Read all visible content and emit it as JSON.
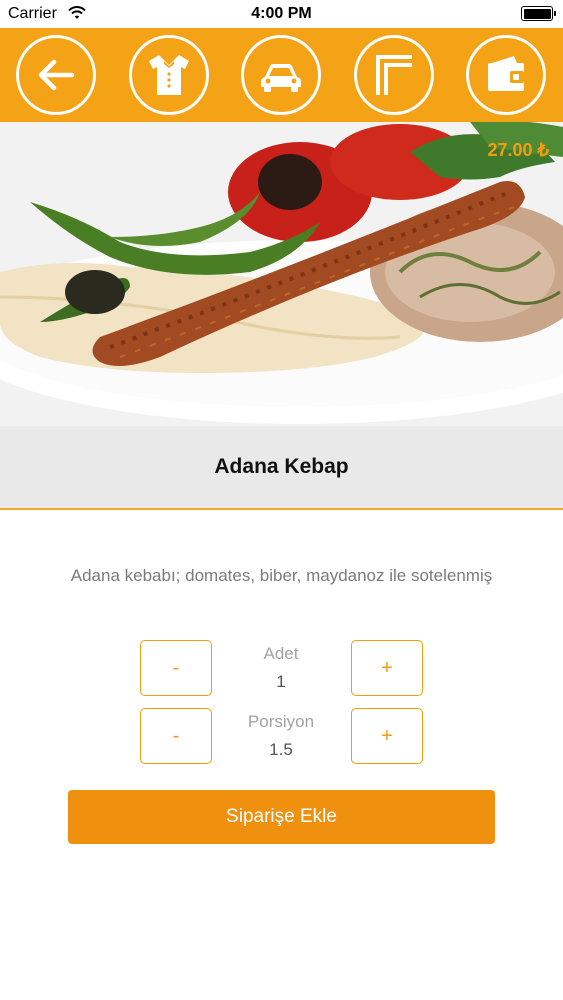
{
  "status_bar": {
    "carrier": "Carrier",
    "time": "4:00 PM"
  },
  "toolbar": {
    "background": "#f5a316",
    "icons": [
      "back-arrow-icon",
      "waiter-icon",
      "car-icon",
      "menu-corner-icon",
      "wallet-icon"
    ]
  },
  "product": {
    "price": "27.00 ₺",
    "name": "Adana Kebap",
    "description": "Adana kebabı; domates, biber, maydanoz ile sotelenmiş"
  },
  "quantity": {
    "label": "Adet",
    "value": "1",
    "minus_label": "-",
    "plus_label": "+"
  },
  "portion": {
    "label": "Porsiyon",
    "value": "1.5",
    "minus_label": "-",
    "plus_label": "+"
  },
  "order": {
    "add_label": "Siparişe Ekle"
  },
  "colors": {
    "accent": "#f39c12",
    "button": "#f0900f",
    "title_band": "#e9e9ea"
  }
}
